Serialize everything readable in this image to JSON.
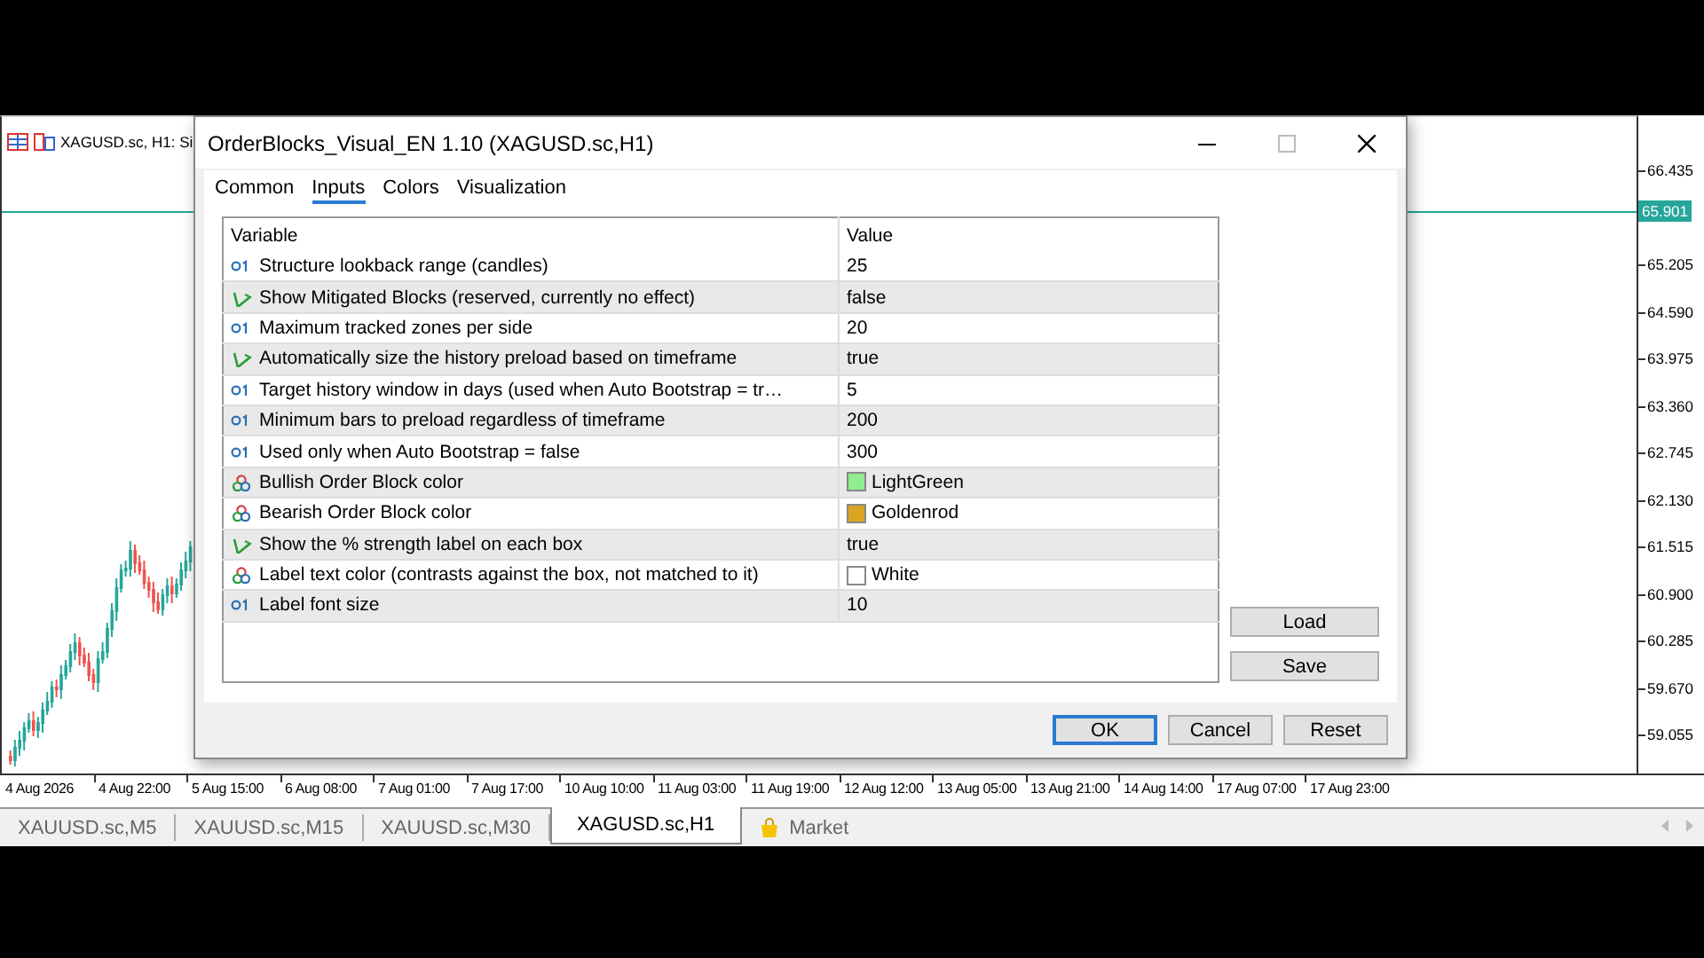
{
  "chart": {
    "title": "XAGUSD.sc, H1: Si",
    "current_price": "65.901",
    "price_ticks": [
      "66.435",
      "65.205",
      "64.590",
      "63.975",
      "63.360",
      "62.745",
      "62.130",
      "61.515",
      "60.900",
      "60.285",
      "59.670",
      "59.055"
    ],
    "time_labels": [
      "4 Aug 2026",
      "4 Aug 22:00",
      "5 Aug 15:00",
      "6 Aug 08:00",
      "7 Aug 01:00",
      "7 Aug 17:00",
      "10 Aug 10:00",
      "11 Aug 03:00",
      "11 Aug 19:00",
      "12 Aug 12:00",
      "13 Aug 05:00",
      "13 Aug 21:00",
      "14 Aug 14:00",
      "17 Aug 07:00",
      "17 Aug 23:00"
    ]
  },
  "dialog": {
    "title": "OrderBlocks_Visual_EN 1.10 (XAGUSD.sc,H1)",
    "tabs": [
      {
        "label": "Common",
        "selected": false
      },
      {
        "label": "Inputs",
        "selected": true
      },
      {
        "label": "Colors",
        "selected": false
      },
      {
        "label": "Visualization",
        "selected": false
      }
    ],
    "table": {
      "columns": [
        "Variable",
        "Value"
      ],
      "rows": [
        {
          "kind": "int",
          "variable": "Structure lookback range (candles)",
          "value": "25"
        },
        {
          "kind": "bool",
          "variable": "Show Mitigated Blocks (reserved, currently no effect)",
          "value": "false"
        },
        {
          "kind": "int",
          "variable": "Maximum tracked zones per side",
          "value": "20"
        },
        {
          "kind": "bool",
          "variable": "Automatically size the history preload based on timeframe",
          "value": "true"
        },
        {
          "kind": "int",
          "variable": "Target history window in days (used when Auto Bootstrap = tr…",
          "value": "5"
        },
        {
          "kind": "int",
          "variable": "Minimum bars to preload regardless of timeframe",
          "value": "200"
        },
        {
          "kind": "int",
          "variable": "Used only when Auto Bootstrap = false",
          "value": "300"
        },
        {
          "kind": "color",
          "variable": "Bullish Order Block color",
          "value": "LightGreen",
          "color": "#90ee90"
        },
        {
          "kind": "color",
          "variable": "Bearish Order Block color",
          "value": "Goldenrod",
          "color": "#daa520"
        },
        {
          "kind": "bool",
          "variable": "Show the % strength label on each box",
          "value": "true"
        },
        {
          "kind": "color",
          "variable": "Label text color (contrasts against the box, not matched to it)",
          "value": "White",
          "color": "#ffffff"
        },
        {
          "kind": "int",
          "variable": "Label font size",
          "value": "10"
        }
      ]
    },
    "side_buttons": [
      "Load",
      "Save"
    ],
    "buttons": [
      {
        "label": "OK",
        "default": true
      },
      {
        "label": "Cancel",
        "default": false
      },
      {
        "label": "Reset",
        "default": false
      }
    ]
  },
  "bottom_tabs": [
    {
      "kind": "chart",
      "label": "XAUUSD.sc,M5",
      "selected": false
    },
    {
      "kind": "chart",
      "label": "XAUUSD.sc,M15",
      "selected": false
    },
    {
      "kind": "chart",
      "label": "XAUUSD.sc,M30",
      "selected": false
    },
    {
      "kind": "chart",
      "label": "XAGUSD.sc,H1",
      "selected": true
    },
    {
      "kind": "market",
      "label": "Market",
      "selected": false
    }
  ]
}
